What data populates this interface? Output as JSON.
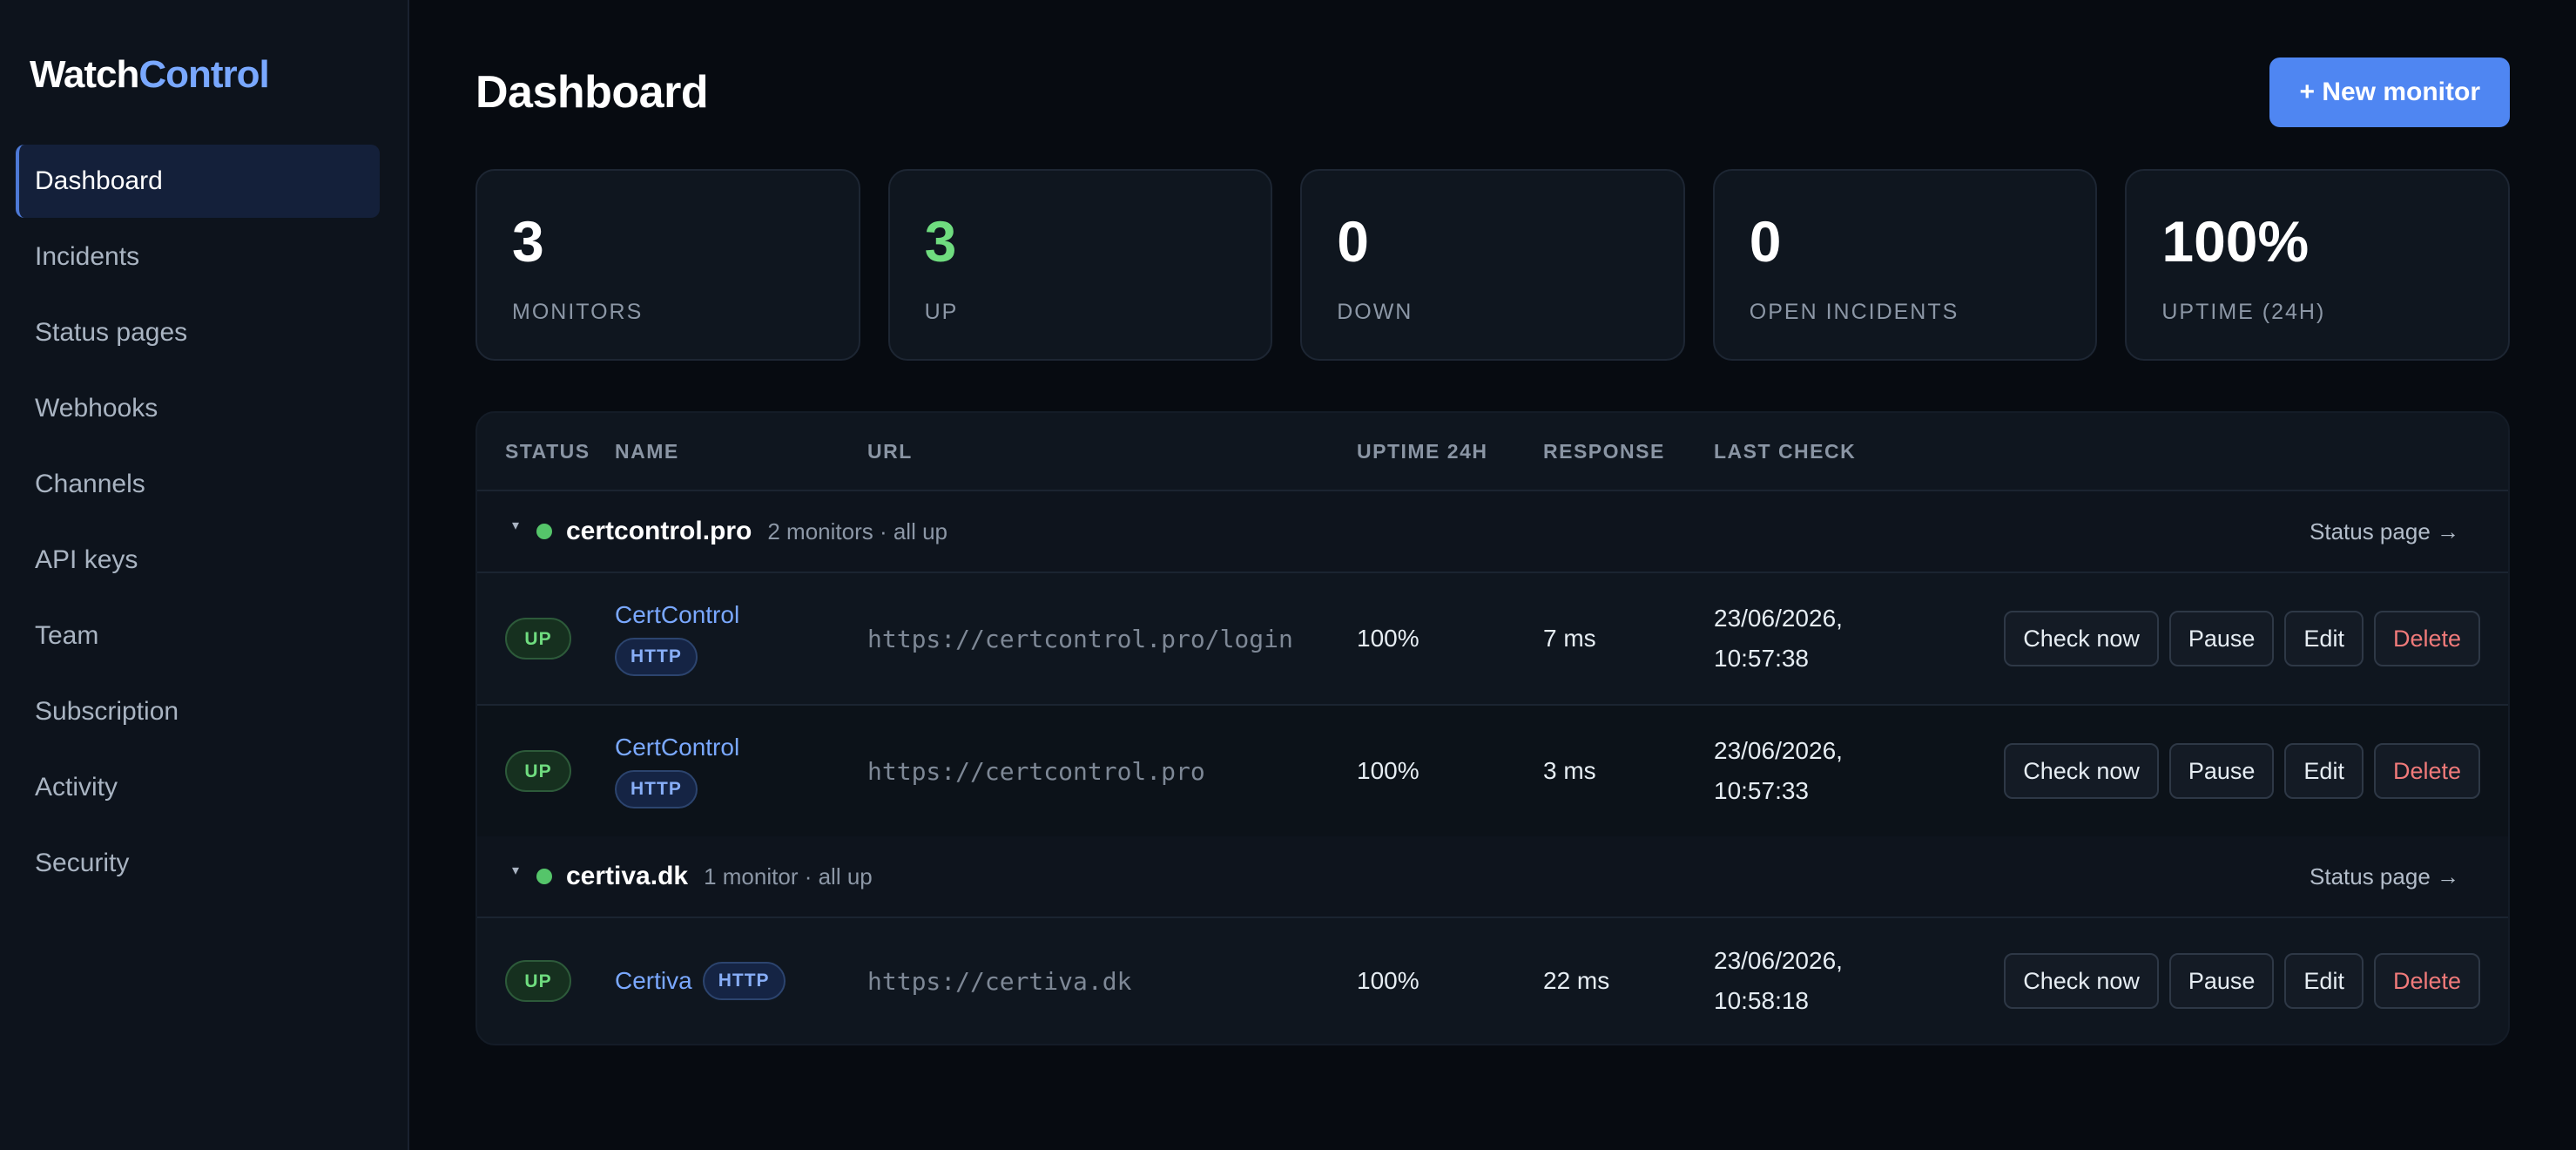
{
  "brand": {
    "part1": "Watch",
    "part2": "Control"
  },
  "sidebar": {
    "items": [
      {
        "label": "Dashboard"
      },
      {
        "label": "Incidents"
      },
      {
        "label": "Status pages"
      },
      {
        "label": "Webhooks"
      },
      {
        "label": "Channels"
      },
      {
        "label": "API keys"
      },
      {
        "label": "Team"
      },
      {
        "label": "Subscription"
      },
      {
        "label": "Activity"
      },
      {
        "label": "Security"
      }
    ]
  },
  "header": {
    "title": "Dashboard",
    "new_button": "+ New monitor"
  },
  "stats": [
    {
      "value": "3",
      "label": "MONITORS"
    },
    {
      "value": "3",
      "label": "UP"
    },
    {
      "value": "0",
      "label": "DOWN"
    },
    {
      "value": "0",
      "label": "OPEN INCIDENTS"
    },
    {
      "value": "100%",
      "label": "UPTIME (24H)"
    }
  ],
  "table": {
    "columns": [
      "STATUS",
      "NAME",
      "URL",
      "UPTIME 24H",
      "RESPONSE",
      "LAST CHECK"
    ],
    "groups": [
      {
        "caret": "▾",
        "name": "certcontrol.pro",
        "summary": "2 monitors · all up",
        "status_link": "Status page →",
        "rows": [
          {
            "status": "UP",
            "name": "CertControl",
            "type": "HTTP",
            "url": "https://certcontrol.pro/login",
            "uptime": "100%",
            "response": "7 ms",
            "date": "23/06/2026,",
            "time": "10:57:38"
          },
          {
            "status": "UP",
            "name": "CertControl",
            "type": "HTTP",
            "url": "https://certcontrol.pro",
            "uptime": "100%",
            "response": "3 ms",
            "date": "23/06/2026,",
            "time": "10:57:33"
          }
        ]
      },
      {
        "caret": "▾",
        "name": "certiva.dk",
        "summary": "1 monitor · all up",
        "status_link": "Status page →",
        "rows": [
          {
            "status": "UP",
            "name": "Certiva",
            "type": "HTTP",
            "url": "https://certiva.dk",
            "uptime": "100%",
            "response": "22 ms",
            "date": "23/06/2026,",
            "time": "10:58:18"
          }
        ]
      }
    ],
    "actions": {
      "check": "Check now",
      "pause": "Pause",
      "edit": "Edit",
      "delete": "Delete"
    }
  },
  "colors": {
    "accent": "#4f86f2",
    "up_green": "#6fdc7f",
    "danger": "#f07a7a",
    "link": "#7aa8ff"
  }
}
